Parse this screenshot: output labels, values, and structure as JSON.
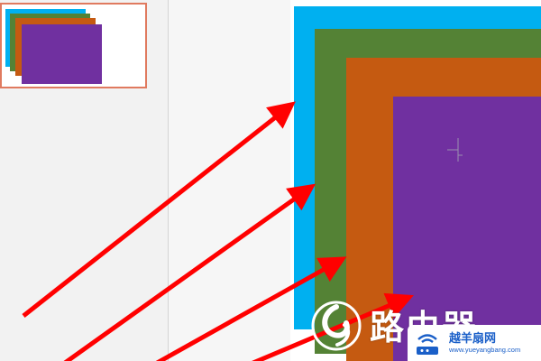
{
  "colors": {
    "cyan": "#00b0f0",
    "green": "#548235",
    "orange": "#c55a11",
    "purple": "#7030a0",
    "arrow": "#ff0000",
    "thumb_border": "#e07a5f",
    "watermark_blue": "#1a5fc8"
  },
  "thumbnail": {
    "layers": [
      "cyan",
      "green",
      "orange",
      "purple"
    ],
    "selected": true
  },
  "slide": {
    "layers": [
      "cyan",
      "green",
      "orange",
      "purple"
    ]
  },
  "annotation": {
    "arrow_count": 4,
    "arrow_targets": [
      "cyan",
      "green",
      "orange",
      "purple"
    ]
  },
  "watermark": {
    "logo_icon": "swirl-logo-icon",
    "title": "路由器",
    "name": "越羊扇网",
    "url": "www.yueyangbang.com",
    "badge_icon": "router-wifi-icon"
  }
}
